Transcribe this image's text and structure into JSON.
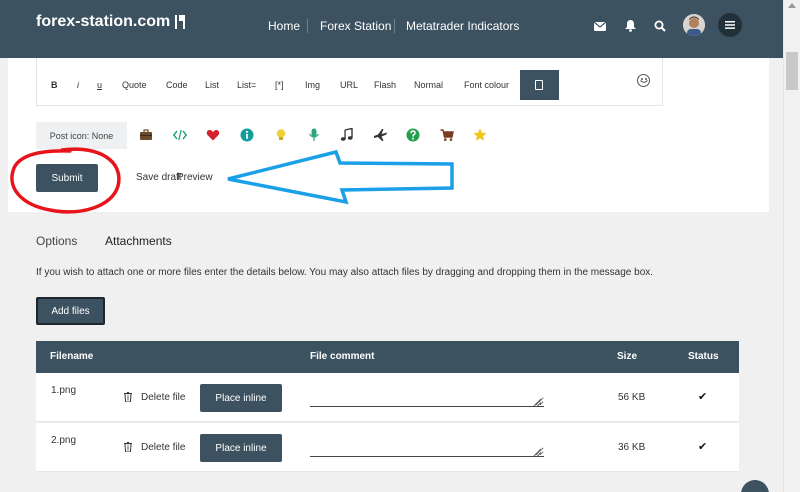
{
  "header": {
    "logo": "forex-station.com",
    "nav": [
      "Home",
      "Forex Station",
      "Metatrader Indicators"
    ],
    "icons": [
      "mail-icon",
      "bell-icon",
      "search-icon",
      "avatar",
      "menu-icon"
    ]
  },
  "editor": {
    "format_buttons": [
      "B",
      "i",
      "u",
      "Quote",
      "Code",
      "List",
      "List=",
      "[*]",
      "Img",
      "URL",
      "Flash",
      "Normal",
      "Font colour"
    ],
    "post_icon_label": "Post icon: None",
    "post_icons": [
      "briefcase-icon",
      "code-icon",
      "heart-icon",
      "info-icon",
      "lightbulb-icon",
      "microphone-icon",
      "music-icon",
      "airplane-icon",
      "question-icon",
      "cart-icon",
      "star-icon"
    ],
    "actions": {
      "submit": "Submit",
      "save_draft": "Save draft",
      "preview": "Preview"
    }
  },
  "tabs": [
    {
      "label": "Options"
    },
    {
      "label": "Attachments"
    }
  ],
  "attachments": {
    "help": "If you wish to attach one or more files enter the details below. You may also attach files by dragging and dropping them in the message box.",
    "add_files": "Add files",
    "columns": [
      "Filename",
      "File comment",
      "Size",
      "Status"
    ],
    "delete_label": "Delete file",
    "place_inline_label": "Place inline",
    "status_symbol": "✔",
    "rows": [
      {
        "filename": "1.png",
        "size": "56 KB"
      },
      {
        "filename": "2.png",
        "size": "36 KB"
      }
    ]
  },
  "colors": {
    "header": "#3d5261",
    "button": "#3d5261",
    "annotation_circle": "#e8141c",
    "annotation_arrow": "#1aa0e6"
  }
}
